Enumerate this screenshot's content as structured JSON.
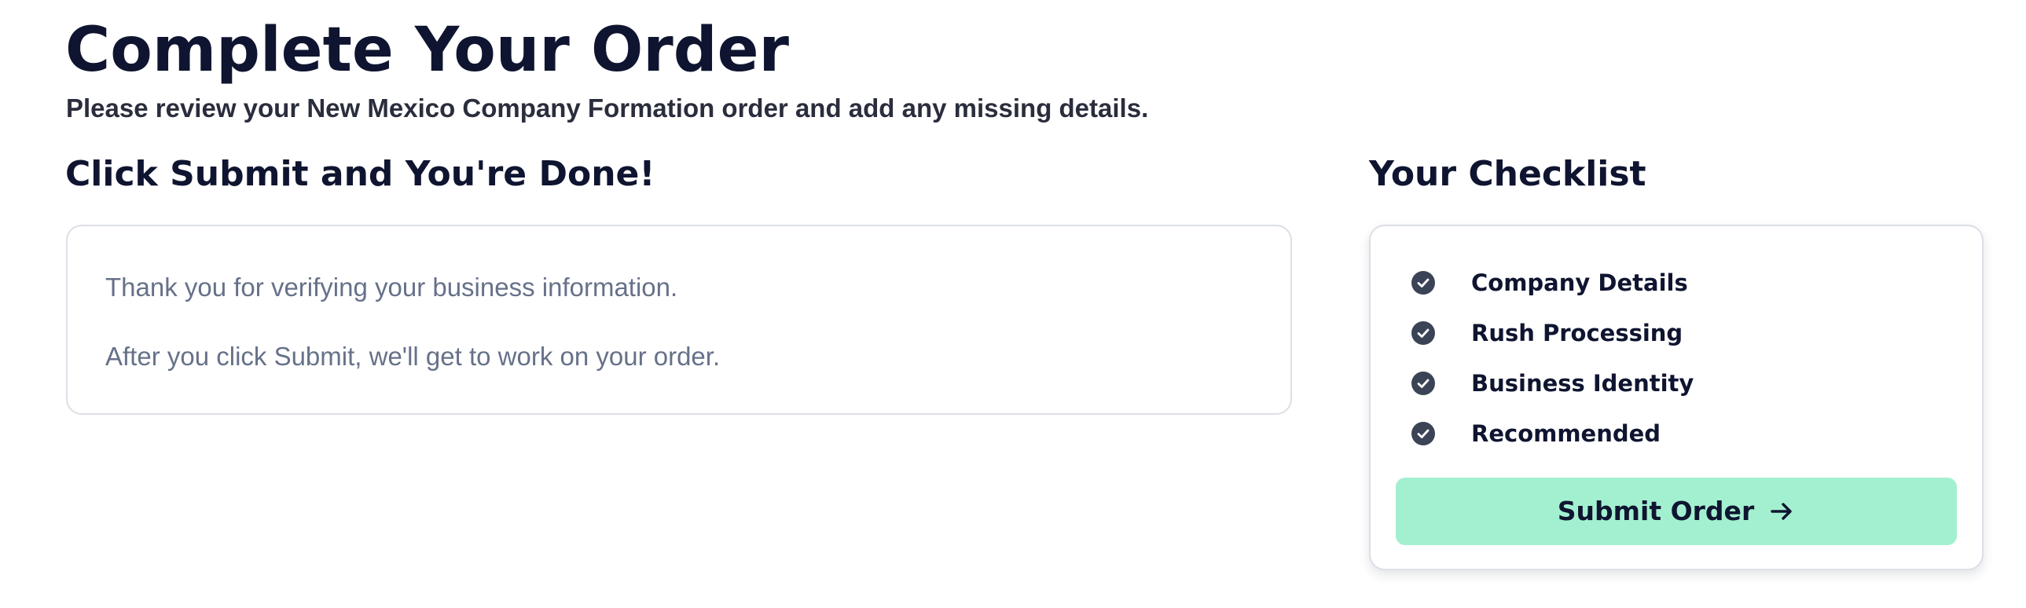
{
  "header": {
    "title": "Complete Your Order",
    "subtitle": "Please review your New Mexico Company Formation order and add any missing details."
  },
  "main": {
    "section_title": "Click Submit and You're Done!",
    "info_lines": [
      "Thank you for verifying your business information.",
      "After you click Submit, we'll get to work on your order."
    ]
  },
  "checklist": {
    "title": "Your Checklist",
    "items": [
      {
        "label": "Company Details",
        "icon": "check-circle-icon",
        "status": "complete"
      },
      {
        "label": "Rush Processing",
        "icon": "check-circle-icon",
        "status": "complete"
      },
      {
        "label": "Business Identity",
        "icon": "check-circle-icon",
        "status": "complete"
      },
      {
        "label": "Recommended",
        "icon": "check-circle-icon",
        "status": "complete"
      }
    ],
    "submit_label": "Submit Order",
    "submit_icon": "arrow-right-icon"
  },
  "colors": {
    "text_primary": "#0f1530",
    "text_muted": "#667189",
    "check_icon": "#3a4456",
    "button_bg": "#a3f0d0",
    "border": "#dcdfe6"
  }
}
